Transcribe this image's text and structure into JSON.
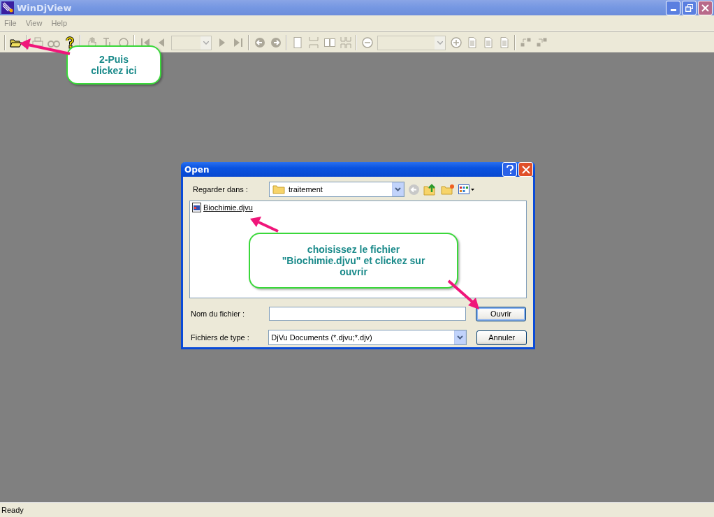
{
  "window": {
    "title": "WinDjView"
  },
  "menu": [
    {
      "label": "File"
    },
    {
      "label": "View"
    },
    {
      "label": "Help"
    }
  ],
  "toolbar": [
    {
      "kind": "separator"
    },
    {
      "kind": "button",
      "disabled": false
    },
    {
      "kind": "separator"
    },
    {
      "kind": "button",
      "disabled": true
    },
    {
      "kind": "button",
      "disabled": true
    },
    {
      "kind": "button",
      "disabled": false
    },
    {
      "kind": "separator"
    },
    {
      "kind": "button",
      "disabled": true
    },
    {
      "kind": "button",
      "disabled": true
    },
    {
      "kind": "button",
      "disabled": true
    },
    {
      "kind": "separator"
    },
    {
      "kind": "button",
      "disabled": true
    },
    {
      "kind": "button",
      "disabled": true
    },
    {
      "kind": "combo",
      "disabled": true
    },
    {
      "kind": "button",
      "disabled": true
    },
    {
      "kind": "button",
      "disabled": true
    },
    {
      "kind": "separator"
    },
    {
      "kind": "button",
      "disabled": true
    },
    {
      "kind": "button",
      "disabled": true
    },
    {
      "kind": "separator"
    },
    {
      "kind": "button",
      "disabled": true
    },
    {
      "kind": "button",
      "disabled": true
    },
    {
      "kind": "button",
      "disabled": true
    },
    {
      "kind": "button",
      "disabled": true
    },
    {
      "kind": "separator"
    },
    {
      "kind": "button",
      "disabled": true
    },
    {
      "kind": "combo",
      "disabled": true
    },
    {
      "kind": "button",
      "disabled": true
    },
    {
      "kind": "button",
      "disabled": true
    },
    {
      "kind": "button",
      "disabled": true
    },
    {
      "kind": "button",
      "disabled": true
    },
    {
      "kind": "separator"
    },
    {
      "kind": "button",
      "disabled": true
    },
    {
      "kind": "button",
      "disabled": true
    }
  ],
  "dialog": {
    "title": "Open",
    "look_in_label": "Regarder dans :",
    "look_in_value": "traitement",
    "files": [
      {
        "name": "Biochimie.djvu"
      }
    ],
    "filename_label": "Nom du fichier :",
    "filetype_label": "Fichiers de type :",
    "filetype_value": "DjVu Documents (*.djvu;*.djv)",
    "buttons": [
      {
        "label": "Ouvrir",
        "default": true
      },
      {
        "label": "Annuler",
        "default": false
      }
    ]
  },
  "callouts": [
    {
      "text": "2-Puis clickez ici"
    },
    {
      "text": "choisissez le fichier \"Biochimie.djvu\" et clickez sur ouvrir"
    }
  ],
  "status_bar": "Ready"
}
